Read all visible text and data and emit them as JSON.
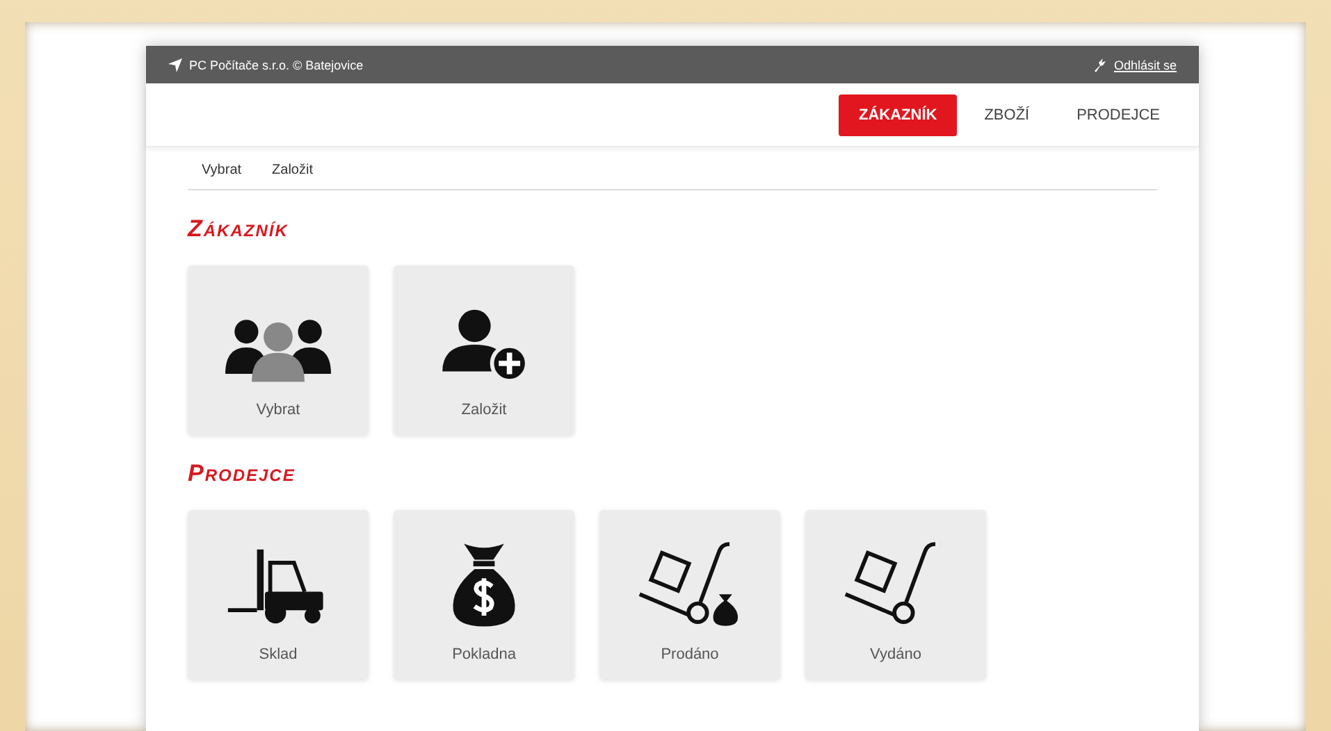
{
  "top_bar": {
    "location": "PC Počítače s.r.o. © Batejovice",
    "logout": "Odhlásit se"
  },
  "tabs": [
    {
      "label": "ZÁKAZNÍK",
      "selected": true
    },
    {
      "label": "ZBOŽÍ",
      "selected": false
    },
    {
      "label": "PRODEJCE",
      "selected": false
    }
  ],
  "subnav": [
    "Vybrat",
    "Založit"
  ],
  "sections": [
    {
      "title": "Zákazník",
      "tiles": [
        {
          "label": "Vybrat",
          "kind": "group"
        },
        {
          "label": "Založit",
          "kind": "add-user"
        }
      ]
    },
    {
      "title": "Prodejce",
      "tiles": [
        {
          "label": "Sklad",
          "kind": "forklift"
        },
        {
          "label": "Pokladna",
          "kind": "money-bag"
        },
        {
          "label": "Prodáno",
          "kind": "cart-money"
        },
        {
          "label": "Vydáno",
          "kind": "cart"
        }
      ]
    }
  ]
}
